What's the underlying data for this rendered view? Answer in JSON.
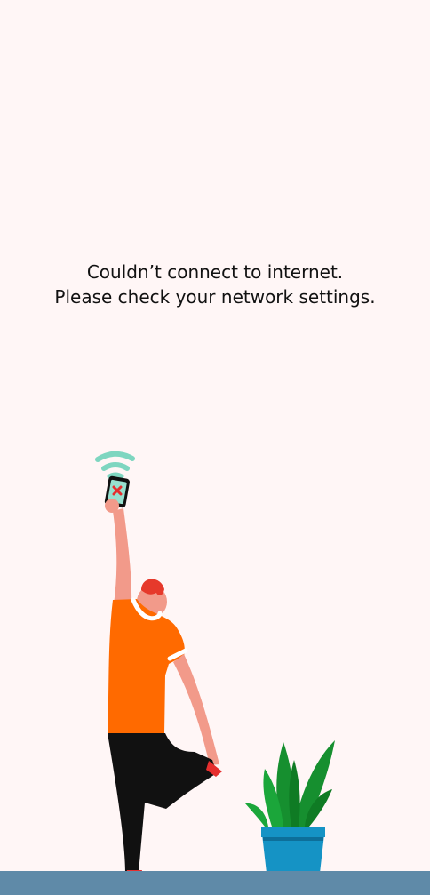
{
  "error": {
    "line1": "Couldn’t connect to internet.",
    "line2": "Please check your network settings."
  },
  "colors": {
    "background": "#fff6f6",
    "floor": "#5f8aa8",
    "shirt": "#ff6a00",
    "pants": "#111111",
    "hair": "#e6392b",
    "skin": "#f29a8a",
    "wifi": "#7ed6c0",
    "pot": "#1593c5",
    "plant": "#168f2f"
  },
  "icons": {
    "wifi": "wifi-signal-icon",
    "phone_error": "phone-error-icon"
  }
}
